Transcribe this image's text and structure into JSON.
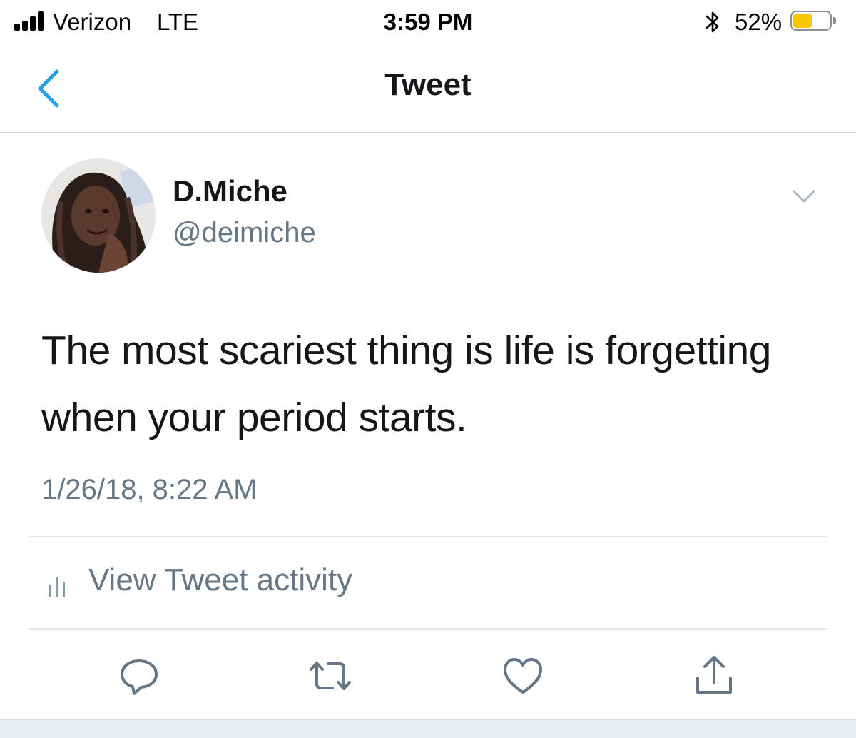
{
  "status_bar": {
    "carrier": "Verizon",
    "network": "LTE",
    "time": "3:59 PM",
    "battery_percent": "52%",
    "battery_level": 0.52,
    "icons": [
      "signal-bars-icon",
      "bluetooth-icon",
      "battery-icon"
    ]
  },
  "nav": {
    "title": "Tweet",
    "back_icon": "chevron-left-icon",
    "accent_color": "#1da1f2"
  },
  "tweet": {
    "display_name": "D.Miche",
    "handle": "@deimiche",
    "text": "The most scariest thing is life is forgetting when your period starts.",
    "timestamp": "1/26/18, 8:22 AM",
    "menu_icon": "chevron-down-icon"
  },
  "activity": {
    "label": "View Tweet activity",
    "icon": "bar-chart-icon"
  },
  "actions": [
    {
      "name": "reply",
      "icon": "comment-bubble-icon"
    },
    {
      "name": "retweet",
      "icon": "retweet-icon"
    },
    {
      "name": "like",
      "icon": "heart-icon"
    },
    {
      "name": "share",
      "icon": "share-icon"
    }
  ],
  "colors": {
    "text": "#14171a",
    "secondary_text": "#657786",
    "divider": "#e1e8ed",
    "battery_fill": "#f6c600"
  }
}
